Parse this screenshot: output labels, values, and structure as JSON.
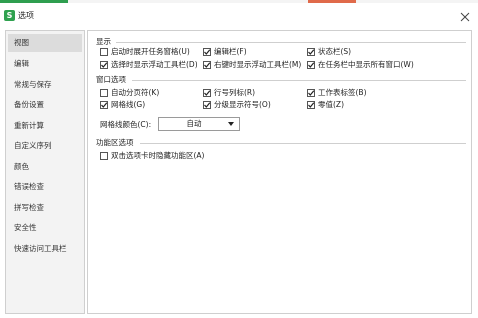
{
  "window": {
    "app_icon_letter": "S",
    "title": "选项"
  },
  "icons": {
    "app": "wps-spreadsheet-icon",
    "close": "close-icon",
    "checkmark": "checkmark-icon",
    "dropdown": "triangle-down-icon"
  },
  "colors": {
    "app_icon_green": "#2fa14f",
    "selected_item_bg": "#dcdcdc",
    "sidebar_bg": "#f3f3f3"
  },
  "sidebar": {
    "items": [
      {
        "label": "视图",
        "active": true
      },
      {
        "label": "编辑",
        "active": false
      },
      {
        "label": "常规与保存",
        "active": false
      },
      {
        "label": "备份设置",
        "active": false
      },
      {
        "label": "重新计算",
        "active": false
      },
      {
        "label": "自定义序列",
        "active": false
      },
      {
        "label": "颜色",
        "active": false
      },
      {
        "label": "错误检查",
        "active": false
      },
      {
        "label": "拼写检查",
        "active": false
      },
      {
        "label": "安全性",
        "active": false
      },
      {
        "label": "快速访问工具栏",
        "active": false
      }
    ]
  },
  "display": {
    "title": "显示",
    "options": [
      {
        "label": "启动时展开任务窗格(U)",
        "checked": false
      },
      {
        "label": "编辑栏(F)",
        "checked": true
      },
      {
        "label": "状态栏(S)",
        "checked": true
      },
      {
        "label": "选择时显示浮动工具栏(D)",
        "checked": true
      },
      {
        "label": "右键时显示浮动工具栏(M)",
        "checked": true
      },
      {
        "label": "在任务栏中显示所有窗口(W)",
        "checked": true
      }
    ]
  },
  "window_options": {
    "title": "窗口选项",
    "options": [
      {
        "label": "自动分页符(K)",
        "checked": false
      },
      {
        "label": "行号列标(R)",
        "checked": true
      },
      {
        "label": "工作表标签(B)",
        "checked": true
      },
      {
        "label": "网格线(G)",
        "checked": true
      },
      {
        "label": "分级显示符号(O)",
        "checked": true
      },
      {
        "label": "零值(Z)",
        "checked": true
      }
    ],
    "gridline_color_label": "网格线颜色(C):",
    "gridline_color_value": "自动"
  },
  "ribbon": {
    "title": "功能区选项",
    "options": [
      {
        "label": "双击选项卡时隐藏功能区(A)",
        "checked": false
      }
    ]
  }
}
